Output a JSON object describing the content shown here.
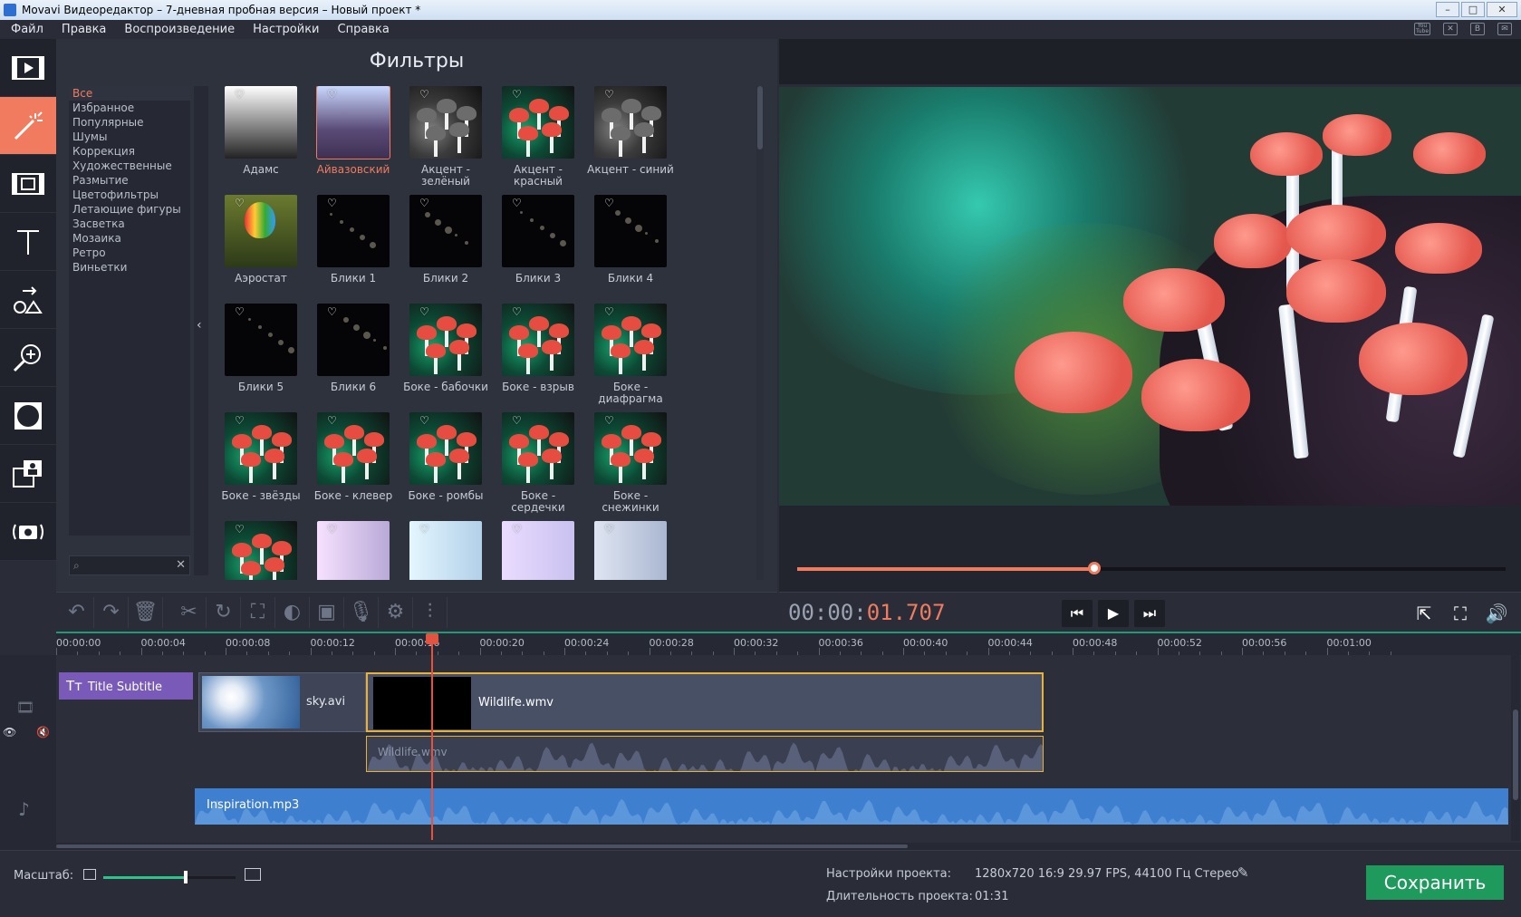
{
  "window": {
    "title": "Movavi Видеоредактор – 7-дневная пробная версия – Новый проект *",
    "buttons": [
      "–",
      "□",
      "✕"
    ]
  },
  "menu": {
    "items": [
      "Файл",
      "Правка",
      "Воспроизведение",
      "Настройки",
      "Справка"
    ],
    "social": [
      "You Tube",
      "✕",
      "B",
      "✉"
    ]
  },
  "left_tools": [
    {
      "name": "import-media-icon"
    },
    {
      "name": "filters-icon",
      "active": true
    },
    {
      "name": "transitions-icon"
    },
    {
      "name": "titles-icon"
    },
    {
      "name": "shapes-icon"
    },
    {
      "name": "zoom-pan-icon"
    },
    {
      "name": "overlay-icon"
    },
    {
      "name": "picture-in-picture-icon"
    },
    {
      "name": "capture-icon"
    }
  ],
  "filters": {
    "title": "Фильтры",
    "categories": [
      "Все",
      "Избранное",
      "Популярные",
      "Шумы",
      "Коррекция",
      "Художественные",
      "Размытие",
      "Цветофильтры",
      "Летающие фигуры",
      "Засветка",
      "Мозаика",
      "Ретро",
      "Виньетки"
    ],
    "selected_category": "Все",
    "collapse_arrow": "‹",
    "heart": "♡",
    "search_icon": "⌕",
    "clear_icon": "✕",
    "items": [
      {
        "label": "Адамс",
        "art": "adams"
      },
      {
        "label": "Айвазовский",
        "art": "aiv",
        "selected": true
      },
      {
        "label": "Акцент - зелёный",
        "art": "mush-gray"
      },
      {
        "label": "Акцент - красный",
        "art": "mush-red"
      },
      {
        "label": "Акцент - синий",
        "art": "mush-gray"
      },
      {
        "label": "Аэростат",
        "art": "balloon"
      },
      {
        "label": "Блики 1",
        "art": "dark"
      },
      {
        "label": "Блики 2",
        "art": "dark"
      },
      {
        "label": "Блики 3",
        "art": "dark"
      },
      {
        "label": "Блики 4",
        "art": "dark"
      },
      {
        "label": "Блики 5",
        "art": "dark"
      },
      {
        "label": "Блики 6",
        "art": "dark"
      },
      {
        "label": "Боке - бабочки",
        "art": "mush-red"
      },
      {
        "label": "Боке - взрыв",
        "art": "mush-red"
      },
      {
        "label": "Боке - диафрагма",
        "art": "mush-red"
      },
      {
        "label": "Боке - звёзды",
        "art": "mush-red"
      },
      {
        "label": "Боке - клевер",
        "art": "mush-red"
      },
      {
        "label": "Боке - ромбы",
        "art": "mush-red"
      },
      {
        "label": "Боке - сердечки",
        "art": "mush-red"
      },
      {
        "label": "Боке - снежинки",
        "art": "mush-red"
      },
      {
        "label": "",
        "art": "mush-red"
      },
      {
        "label": "",
        "art": "pink"
      },
      {
        "label": "",
        "art": "ice"
      },
      {
        "label": "",
        "art": "lav"
      },
      {
        "label": "",
        "art": "steel"
      }
    ]
  },
  "edit_tools": [
    "↶",
    "↷",
    "🗑",
    "✂",
    "↻",
    "⛶",
    "◐",
    "▣",
    "🎙",
    "⚙",
    "⫶"
  ],
  "player": {
    "time_gray": "00:00:",
    "time_red": "01.707",
    "progress": 0.42,
    "prev": "⏮",
    "play": "▶",
    "next": "⏭",
    "popout": "⇱",
    "fullscreen": "⛶",
    "volume": "🔊"
  },
  "timeline": {
    "ticks": [
      "00:00:00",
      "00:00:04",
      "00:00:08",
      "00:00:12",
      "00:00:16",
      "00:00:20",
      "00:00:24",
      "00:00:28",
      "00:00:32",
      "00:00:36",
      "00:00:40",
      "00:00:44",
      "00:00:48",
      "00:00:52",
      "00:00:56",
      "00:01:00"
    ],
    "title_clip": "Title Subtitle",
    "title_icon": "Tт",
    "video_clips": [
      "sky.avi",
      "Wildlife.wmv"
    ],
    "audio_clip_linked": "Wildlife.wmv",
    "music_clip": "Inspiration.mp3",
    "side_icons": [
      "🎞",
      "👁",
      "🔇",
      "♪"
    ]
  },
  "status": {
    "scale_label": "Масштаб:",
    "scale_value": 0.62,
    "project_settings_label": "Настройки проекта:",
    "project_settings_value": "1280x720 16:9 29.97 FPS, 44100 Гц Стерео",
    "edit_icon": "✎",
    "duration_label": "Длительность проекта:",
    "duration_value": "01:31",
    "save_button": "Сохранить"
  },
  "colors": {
    "accent": "#f07b5f",
    "save": "#1f9a5d",
    "title_clip": "#7a5ab8",
    "music": "#3f7fcf",
    "selection": "#e7b13a"
  }
}
